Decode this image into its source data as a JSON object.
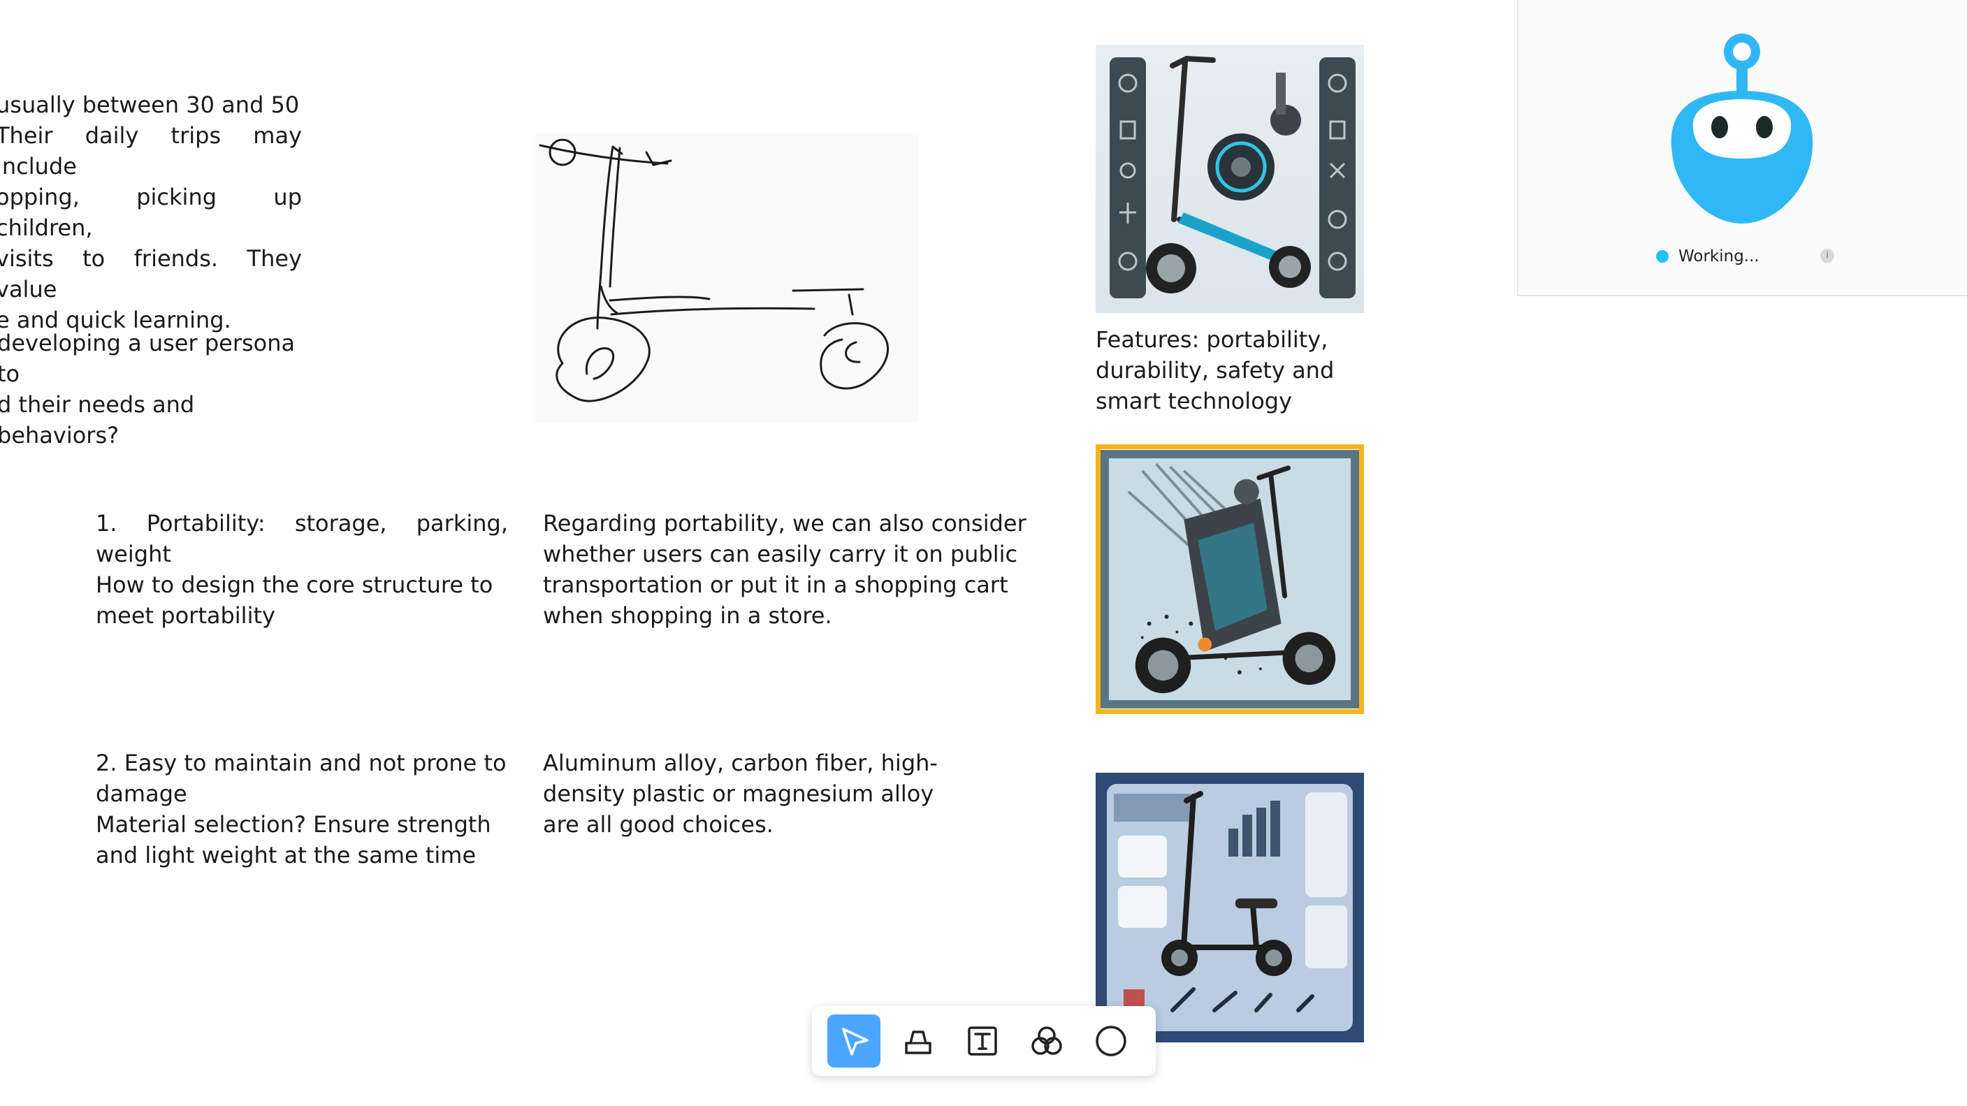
{
  "notes": {
    "persona_text": "usually between 30 and 50\nTheir daily trips may include\nopping, picking up children,\nvisits to friends. They value\ne and quick learning.",
    "persona_question": "developing a user persona to\nd their needs and behaviors?",
    "portability_point": "1. Portability: storage, parking, weight\nHow to design the core structure to\nmeet portability",
    "portability_detail": "Regarding portability, we can also consider\nwhether users can easily carry it on public\ntransportation or put it in a shopping cart\nwhen shopping in a store.",
    "features_caption": "Features: portability,\ndurability, safety and\nsmart technology",
    "maintenance_point": "2. Easy to maintain and not prone to\ndamage\nMaterial selection? Ensure strength\nand light weight at the same time",
    "materials_detail": "Aluminum alloy, carbon fiber, high-\ndensity plastic or magnesium alloy\nare all good choices."
  },
  "assistant": {
    "status": "Working...",
    "status_color": "#1fc3f2",
    "info_icon": "i"
  },
  "toolbar": {
    "tools": [
      "select-arrow-icon",
      "eraser-icon",
      "text-tool-icon",
      "shapes-icon",
      "circle-icon"
    ],
    "active_tool": "select-arrow-icon",
    "accent": "#4ba6ff"
  },
  "colors": {
    "selection_border": "#f4b41a",
    "robot_blue": "#2fb8f5"
  }
}
